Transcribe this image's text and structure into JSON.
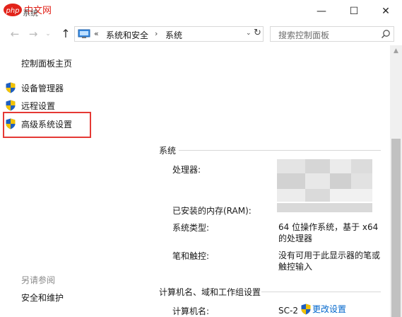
{
  "window": {
    "title": "系统",
    "logo_text": "php中文网",
    "minimize_glyph": "—",
    "maximize_glyph": "☐",
    "close_glyph": "✕"
  },
  "nav": {
    "back_glyph": "←",
    "forward_glyph": "→",
    "history_glyph": "⌄",
    "up_glyph": "↑",
    "address_chevron": "«",
    "breadcrumb_1": "系统和安全",
    "breadcrumb_sep": "›",
    "breadcrumb_2": "系统",
    "dropdown_glyph": "⌄",
    "refresh_glyph": "↻",
    "search_placeholder": "搜索控制面板"
  },
  "left_pane": {
    "home": "控制面板主页",
    "tasks": [
      {
        "label": "设备管理器",
        "icon": "shield-icon"
      },
      {
        "label": "远程设置",
        "icon": "shield-icon"
      },
      {
        "label": "高级系统设置",
        "icon": "shield-icon"
      }
    ],
    "see_also_title": "另请参阅",
    "see_also_links": [
      "安全和维护"
    ]
  },
  "system_section": {
    "title": "系统",
    "rows": [
      {
        "label": "处理器:",
        "value": ""
      },
      {
        "label": "已安装的内存(RAM):",
        "value": ""
      },
      {
        "label": "系统类型:",
        "value": "64 位操作系统，基于 x64 的处理器"
      },
      {
        "label": "笔和触控:",
        "value": "没有可用于此显示器的笔或触控输入"
      }
    ]
  },
  "computer_section": {
    "title": "计算机名、域和工作组设置",
    "rows": [
      {
        "label": "计算机名:",
        "value": "SC-2"
      }
    ],
    "change_link": "更改设置"
  },
  "colors": {
    "highlight_box": "#e53935",
    "link": "#0066cc",
    "logo_red": "#e2231a",
    "shield_blue": "#1f5fbf",
    "shield_yellow": "#f2c200"
  }
}
